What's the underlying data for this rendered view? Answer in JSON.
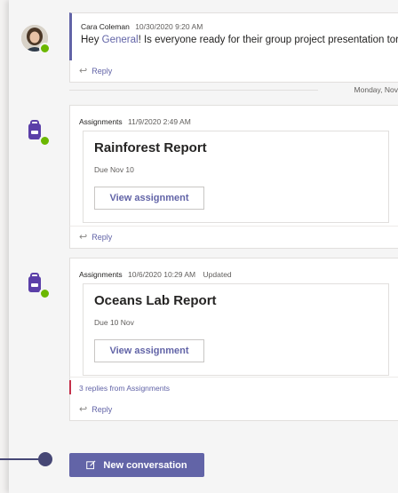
{
  "colors": {
    "accent": "#6264a7",
    "presence": "#6bb700",
    "callout": "#464775",
    "replies_marker": "#c4314b"
  },
  "message": {
    "author": "Cara Coleman",
    "timestamp": "10/30/2020 9:20 AM",
    "text_before": "Hey ",
    "mention": "General",
    "text_after": "! Is everyone ready for their group project presentation tor",
    "reply_label": "Reply"
  },
  "date_separator": "Monday, Nov",
  "assignments": [
    {
      "author": "Assignments",
      "timestamp": "11/9/2020 2:49 AM",
      "status": "",
      "title": "Rainforest Report",
      "due": "Due Nov 10",
      "button_label": "View assignment",
      "reply_label": "Reply"
    },
    {
      "author": "Assignments",
      "timestamp": "10/6/2020 10:29 AM",
      "status": "Updated",
      "title": "Oceans Lab Report",
      "due": "Due 10 Nov",
      "button_label": "View assignment",
      "replies_from": "3 replies from Assignments",
      "reply_label": "Reply"
    }
  ],
  "new_conversation_label": "New conversation",
  "icons": {
    "reply": "reply-icon",
    "compose": "compose-icon",
    "backpack": "backpack-icon"
  }
}
